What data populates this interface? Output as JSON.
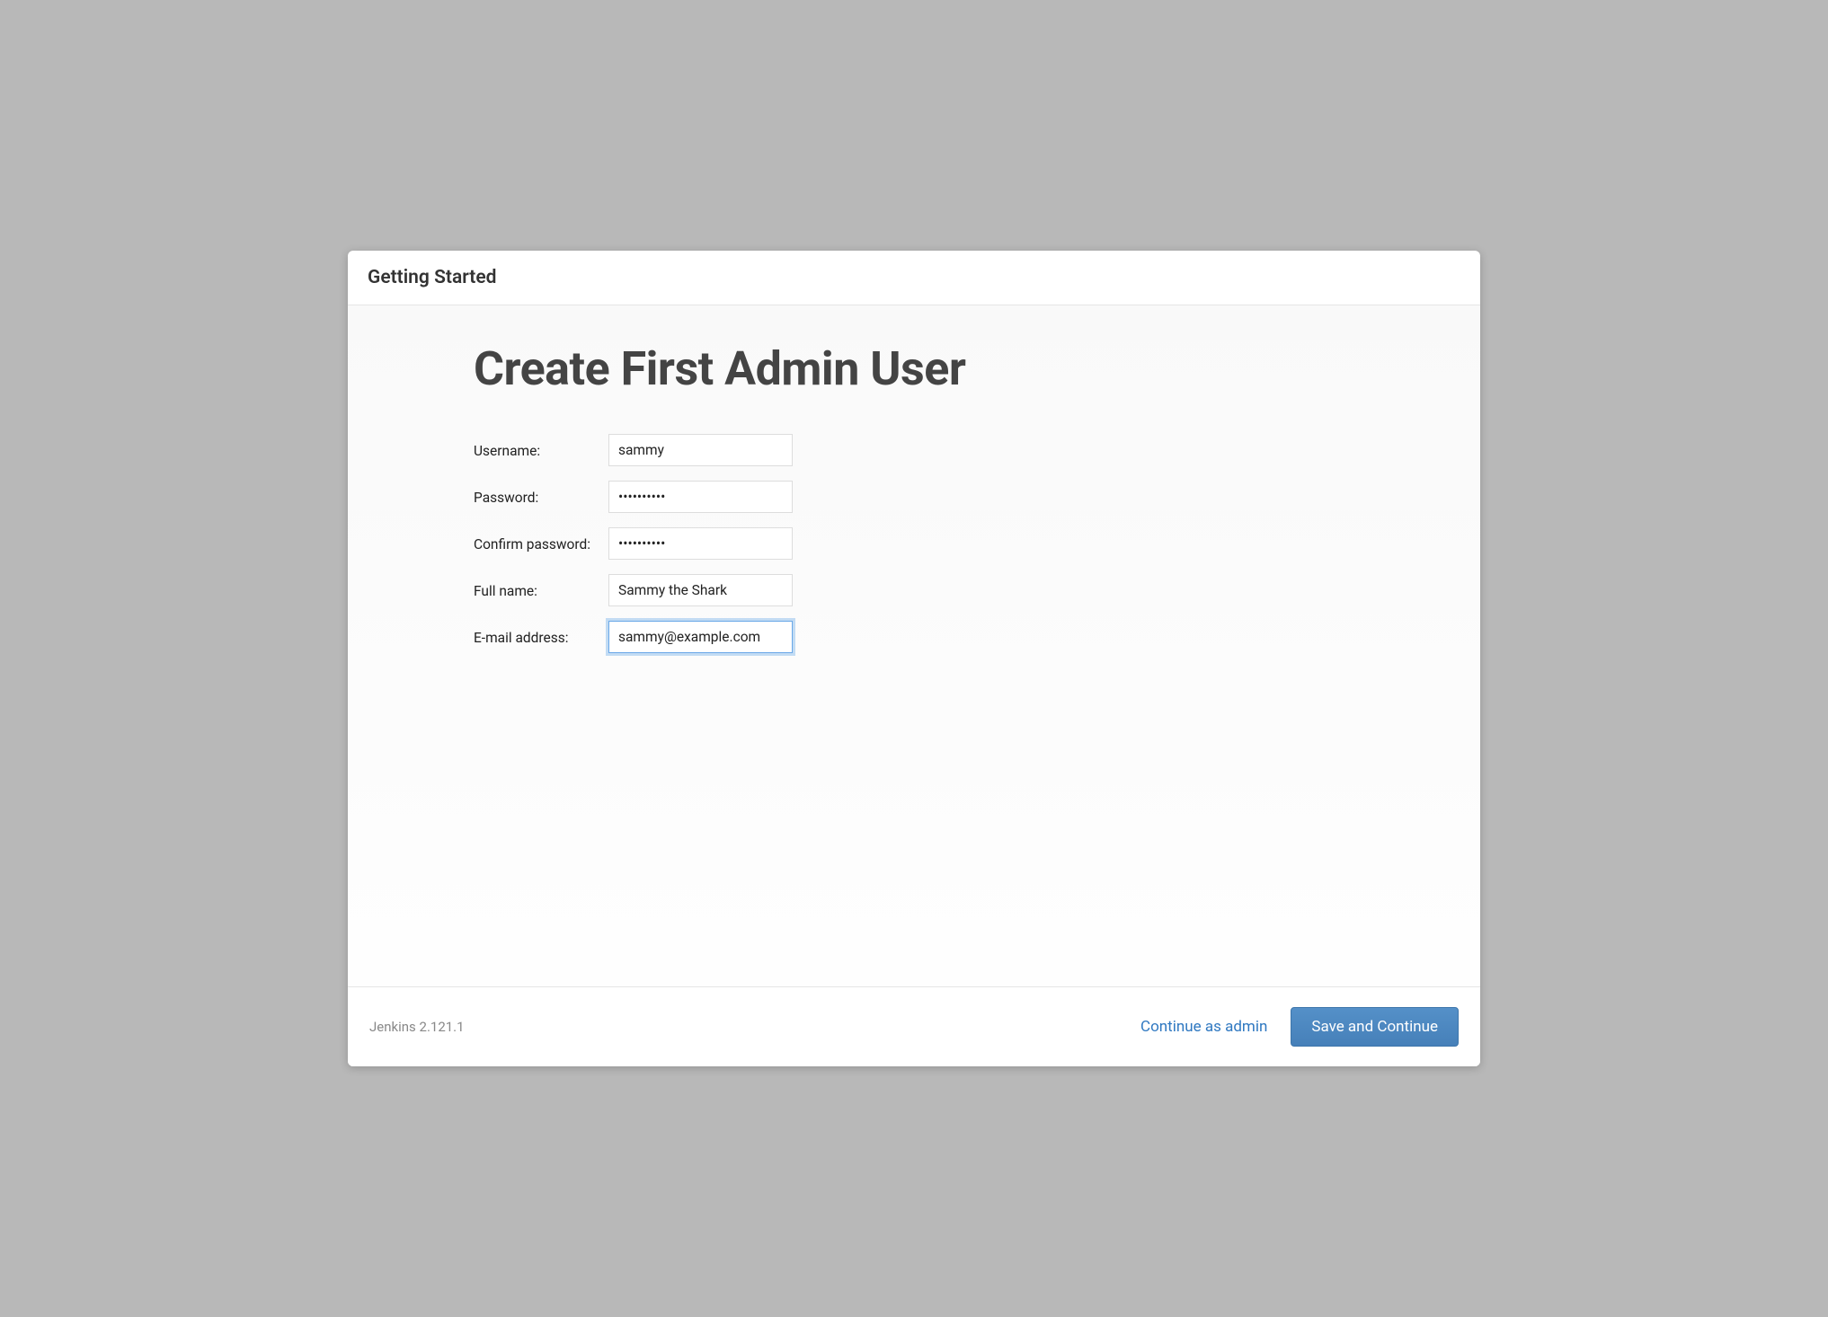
{
  "header": {
    "title": "Getting Started"
  },
  "main": {
    "heading": "Create First Admin User",
    "form": {
      "username": {
        "label": "Username:",
        "value": "sammy"
      },
      "password": {
        "label": "Password:",
        "value": "••••••••••"
      },
      "confirm_password": {
        "label": "Confirm password:",
        "value": "••••••••••"
      },
      "full_name": {
        "label": "Full name:",
        "value": "Sammy the Shark"
      },
      "email": {
        "label": "E-mail address:",
        "value": "sammy@example.com"
      }
    }
  },
  "footer": {
    "version": "Jenkins 2.121.1",
    "continue_as_admin": "Continue as admin",
    "save_continue": "Save and Continue"
  }
}
